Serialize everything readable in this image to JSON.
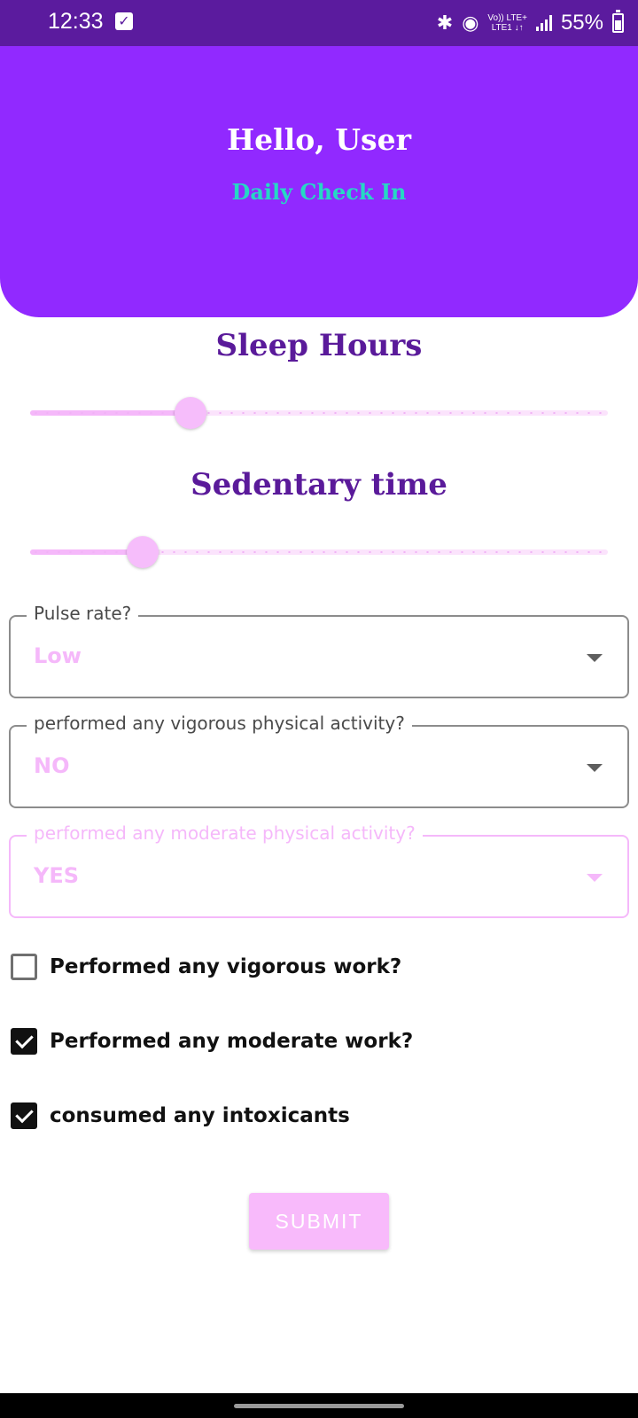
{
  "status_bar": {
    "time": "12:33",
    "network_top": "Vo)) LTE+",
    "network_bottom": "LTE1 ↓↑",
    "battery": "55%",
    "icons": [
      "check-notification-icon",
      "bluetooth-icon",
      "hotspot-icon",
      "signal-icon",
      "battery-icon"
    ]
  },
  "header": {
    "greeting": "Hello, User",
    "subtitle": "Daily Check In"
  },
  "sleep": {
    "title": "Sleep Hours",
    "value_fraction": 0.277
  },
  "sedentary": {
    "title": "Sedentary time",
    "value_fraction": 0.195
  },
  "fields": [
    {
      "label": "Pulse rate?",
      "value": "Low",
      "enabled": true
    },
    {
      "label": "performed any vigorous physical activity?",
      "value": "NO",
      "enabled": true
    },
    {
      "label": "performed any moderate physical activity?",
      "value": "YES",
      "enabled": false
    }
  ],
  "checks": [
    {
      "label": "Performed any vigorous work?",
      "checked": false
    },
    {
      "label": "Performed any moderate work?",
      "checked": true
    },
    {
      "label": "consumed any intoxicants",
      "checked": true
    }
  ],
  "submit_label": "SUBMIT",
  "colors": {
    "status_bar": "#5b1b9e",
    "header": "#9129ff",
    "subtitle": "#26d8c4",
    "title": "#5a1a9a",
    "accent_pink": "#f5b8fa"
  }
}
